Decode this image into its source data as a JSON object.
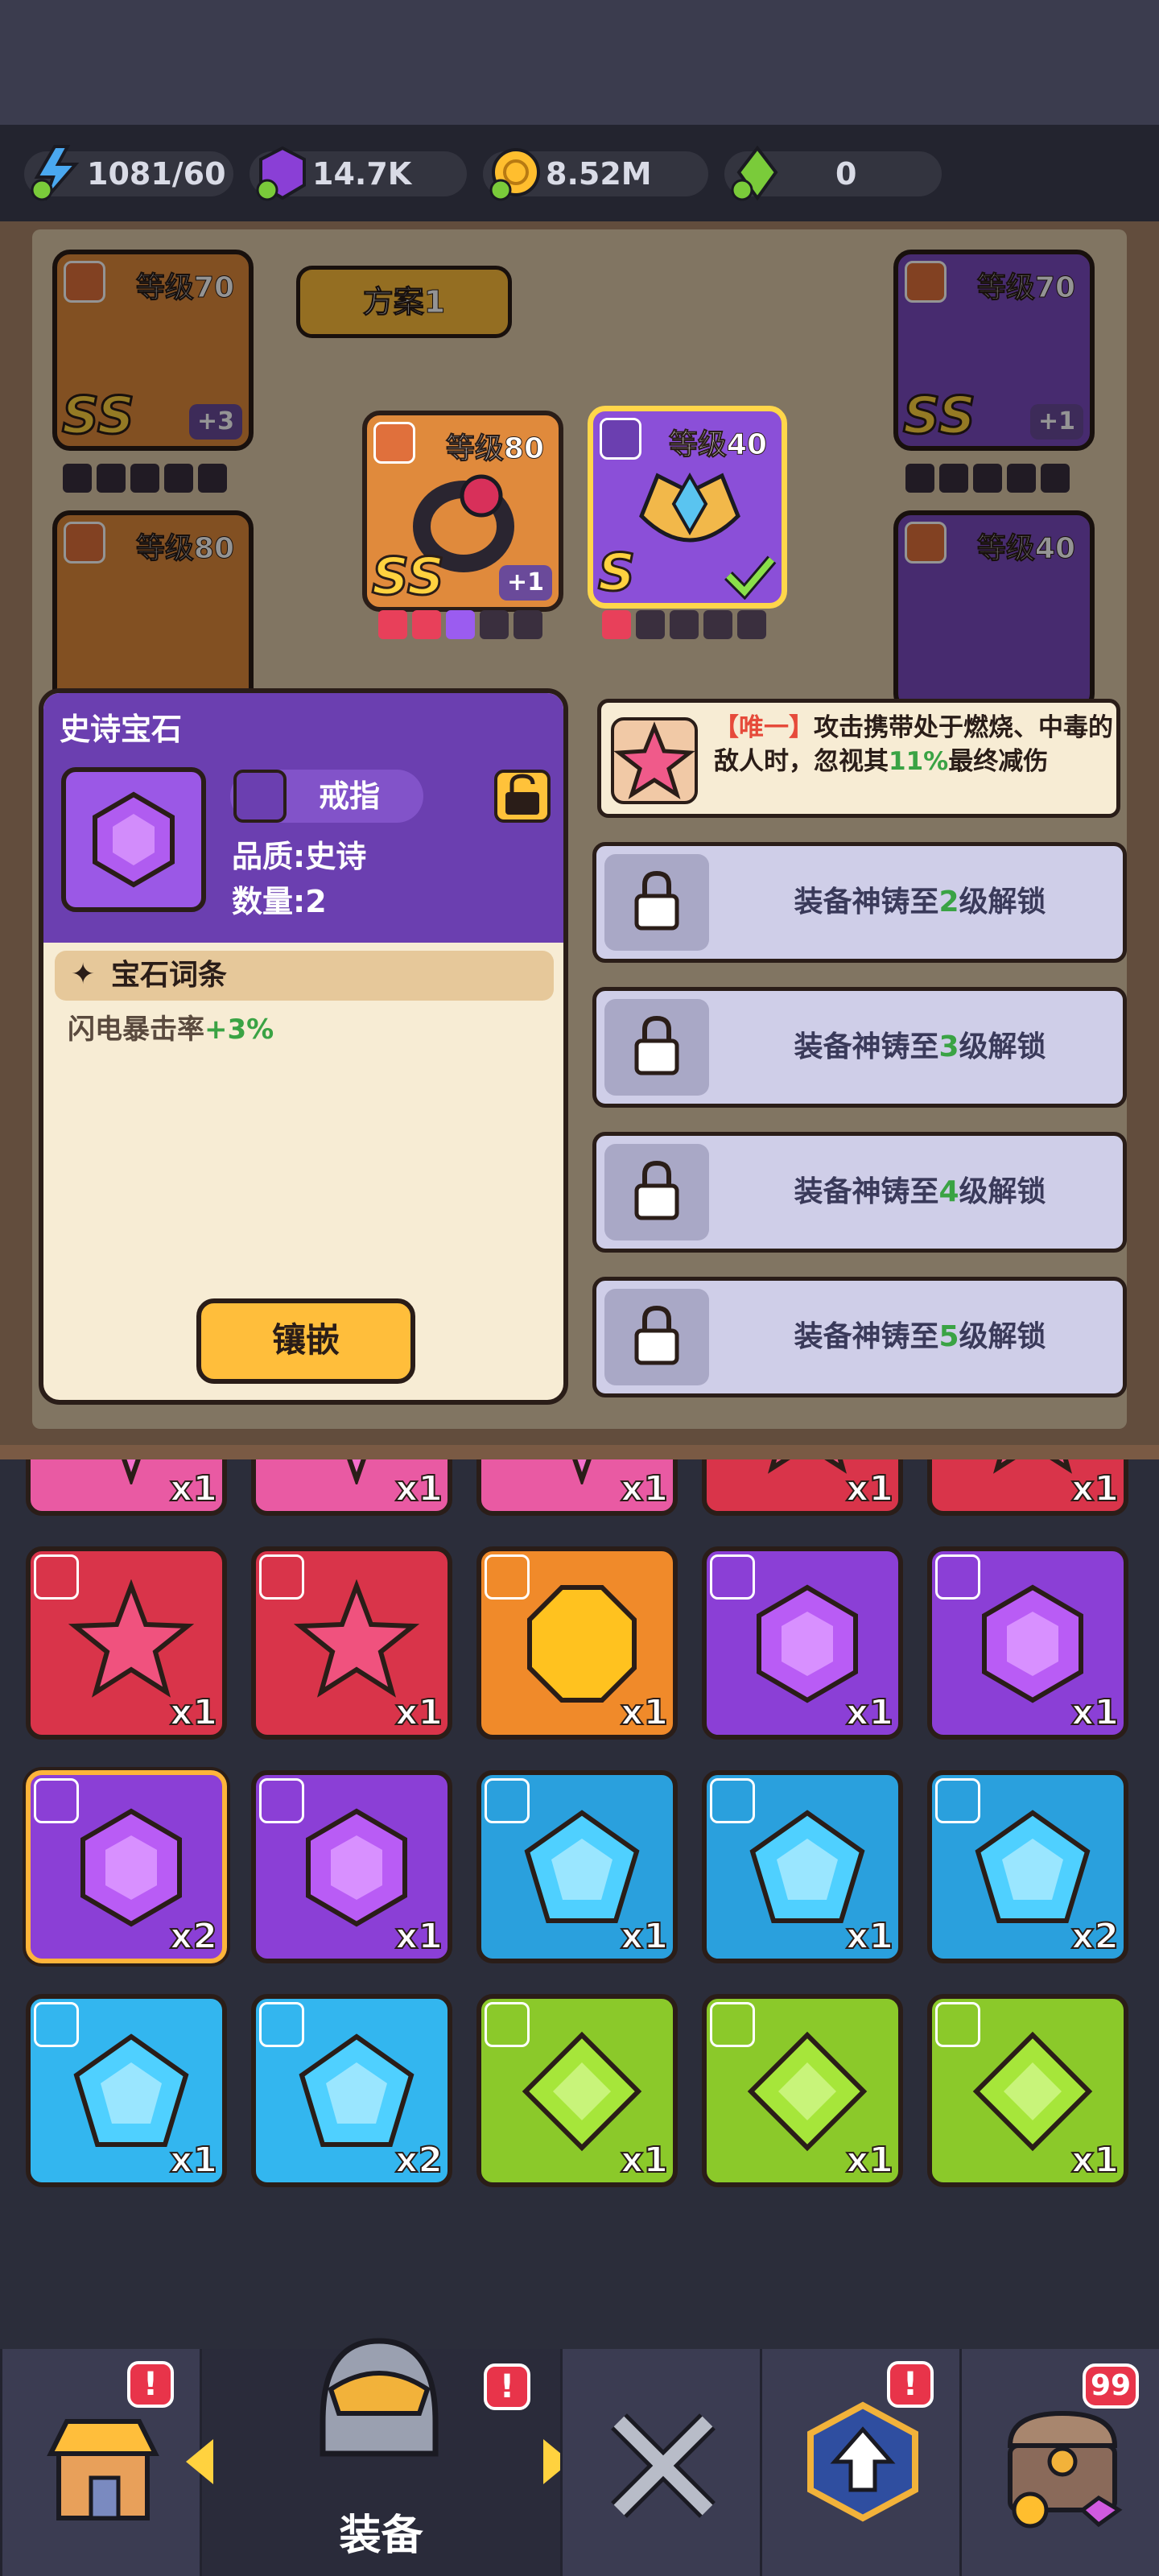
{
  "resources": {
    "energy": "1081/60",
    "gems": "14.7K",
    "gold": "8.52M",
    "crystal": "0"
  },
  "scene": {
    "plan_label": "方案1",
    "slots": [
      {
        "level": "等级70",
        "grade": "SS",
        "plus": "+3"
      },
      {
        "level": "等级80",
        "grade": "SS",
        "plus": "+1"
      },
      {
        "level": "等级40",
        "grade": "S",
        "plus": ""
      },
      {
        "level": "等级70",
        "grade": "SS",
        "plus": "+1"
      },
      {
        "level": "等级80",
        "grade": "",
        "plus": ""
      },
      {
        "level": "等级40",
        "grade": "",
        "plus": ""
      }
    ]
  },
  "popup": {
    "title": "史诗宝石",
    "slot_type": "戒指",
    "quality": "品质:史诗",
    "quantity": "数量:2",
    "section_title": "宝石词条",
    "affix_name": "闪电暴击率",
    "affix_value": "+3%",
    "inlay_button": "镶嵌"
  },
  "unique_effect": {
    "tag": "【唯一】",
    "text_before": "攻击携带处于燃烧、中毒的敌人时，忽视其",
    "value": "11%",
    "text_after": "最终减伤"
  },
  "locked_slots": [
    {
      "prefix": "装备神铸至",
      "level": "2",
      "suffix": "级解锁"
    },
    {
      "prefix": "装备神铸至",
      "level": "3",
      "suffix": "级解锁"
    },
    {
      "prefix": "装备神铸至",
      "level": "4",
      "suffix": "级解锁"
    },
    {
      "prefix": "装备神铸至",
      "level": "5",
      "suffix": "级解锁"
    }
  ],
  "inventory": [
    {
      "gem": "pink-burst",
      "color": "#e95aa3",
      "count": "x1"
    },
    {
      "gem": "pink-burst",
      "color": "#e95aa3",
      "count": "x1"
    },
    {
      "gem": "pink-burst",
      "color": "#e95aa3",
      "count": "x1"
    },
    {
      "gem": "red-star",
      "color": "#d9344a",
      "count": "x1"
    },
    {
      "gem": "red-star",
      "color": "#d9344a",
      "count": "x1"
    },
    {
      "gem": "red-star",
      "color": "#d9344a",
      "count": "x1"
    },
    {
      "gem": "red-star",
      "color": "#d9344a",
      "count": "x1"
    },
    {
      "gem": "gold-octagon",
      "color": "#f08a2a",
      "count": "x1"
    },
    {
      "gem": "purple-hexagon",
      "color": "#8b3fd6",
      "count": "x1"
    },
    {
      "gem": "purple-hexagon",
      "color": "#8b3fd6",
      "count": "x1"
    },
    {
      "gem": "purple-hexagon",
      "color": "#8b3fd6",
      "count": "x2"
    },
    {
      "gem": "purple-hexagon",
      "color": "#8b3fd6",
      "count": "x1"
    },
    {
      "gem": "blue-pentagon",
      "color": "#2aa0dd",
      "count": "x1"
    },
    {
      "gem": "blue-pentagon",
      "color": "#2aa0dd",
      "count": "x1"
    },
    {
      "gem": "blue-pentagon",
      "color": "#2aa0dd",
      "count": "x2"
    },
    {
      "gem": "blue-pentagon",
      "color": "#33b6ef",
      "count": "x1"
    },
    {
      "gem": "blue-pentagon",
      "color": "#33b6ef",
      "count": "x2"
    },
    {
      "gem": "green-diamond",
      "color": "#8bc92a",
      "count": "x1"
    },
    {
      "gem": "green-diamond",
      "color": "#8bc92a",
      "count": "x1"
    },
    {
      "gem": "green-diamond",
      "color": "#8bc92a",
      "count": "x1"
    }
  ],
  "nav": {
    "active_label": "装备",
    "shop_badge": "!",
    "equip_badge": "!",
    "upgrade_badge": "!",
    "chest_count": "99"
  }
}
